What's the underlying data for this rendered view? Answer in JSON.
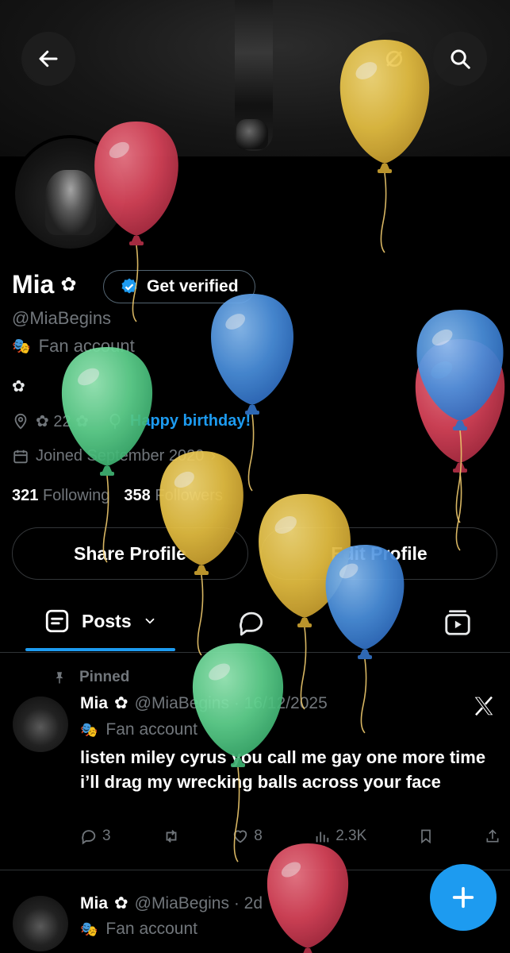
{
  "header": {
    "back_icon": "arrow-left-icon",
    "search_icon": "search-icon",
    "more_icon": "link-off-icon"
  },
  "profile": {
    "name": "Mia",
    "name_emoji": "✿",
    "verify_label": "Get verified",
    "handle": "@MiaBegins",
    "bio_emoji": "🎭",
    "bio_line": "Fan account",
    "bio_second": "✿",
    "location": "✿ 22 ✿",
    "birthday_link": "Happy birthday!",
    "joined": "Joined September 2020",
    "following_count": "321",
    "following_label": "Following",
    "followers_count": "358",
    "followers_label": "Followers"
  },
  "buttons": {
    "share": "Share Profile",
    "edit": "Edit Profile"
  },
  "tabs": {
    "posts": "Posts"
  },
  "pinned_post": {
    "pinned_label": "Pinned",
    "name": "Mia",
    "name_emoji": "✿",
    "handle_date": "@MiaBegins · 16/12/2025",
    "sub_emoji": "🎭",
    "sub": "Fan account",
    "text": "listen miley cyrus you call me gay one more time i’ll drag my wrecking balls across your face",
    "replies": "3",
    "likes": "8",
    "views": "2.3K"
  },
  "second_post": {
    "name": "Mia",
    "name_emoji": "✿",
    "handle_date": "@MiaBegins · 2d",
    "sub_emoji": "🎭",
    "sub": "Fan account"
  },
  "colors": {
    "accent": "#1d9bf0",
    "balloon_red": "#d94a5e",
    "balloon_yellow": "#e8c44a",
    "balloon_blue": "#4a8fdc",
    "balloon_green": "#5fd28e"
  }
}
